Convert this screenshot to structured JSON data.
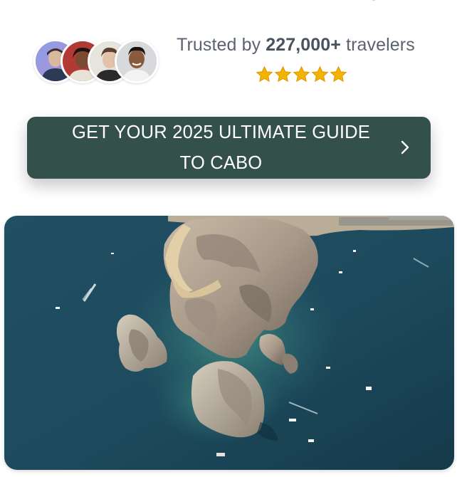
{
  "social_proof": {
    "prefix": "Trusted by",
    "count": "227,000+",
    "suffix": "travelers",
    "rating_stars": 5,
    "avatars": [
      "traveler-avatar-1",
      "traveler-avatar-2",
      "traveler-avatar-3",
      "traveler-avatar-4"
    ]
  },
  "cta": {
    "line1": "GET YOUR 2025 ULTIMATE GUIDE",
    "line2": "TO CABO",
    "icon": "chevron-right-icon"
  },
  "hero": {
    "image": "aerial-photo-los-arcos-cabo"
  },
  "colors": {
    "button_bg": "#34504a",
    "button_text": "#ffffff",
    "star": "#f5b301",
    "text": "#5b6370"
  }
}
